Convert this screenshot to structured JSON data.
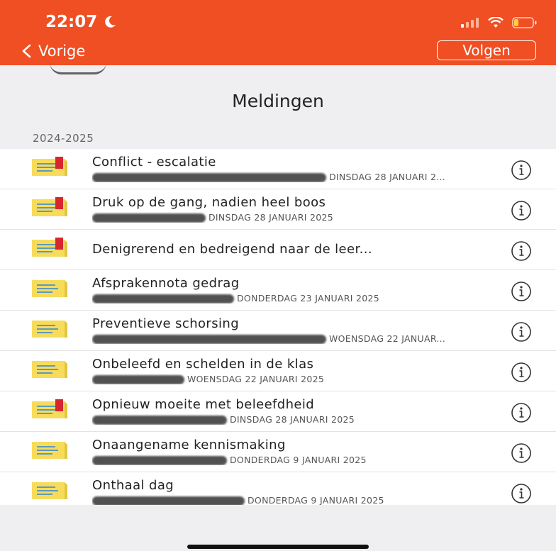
{
  "status_bar": {
    "time": "22:07"
  },
  "nav": {
    "back_label": "Vorige",
    "follow_label": "Volgen"
  },
  "page_title": "Meldingen",
  "section_label": "2024-2025",
  "items": [
    {
      "title": "Conflict - escalatie",
      "subtitle": "DINSDAG 28 JANUARI 2...",
      "flag": true,
      "redact_w": 330
    },
    {
      "title": "Druk op de gang, nadien heel boos",
      "subtitle": "DINSDAG 28 JANUARI 2025",
      "flag": true,
      "redact_w": 160
    },
    {
      "title": "Denigrerend en bedreigend naar de leer...",
      "subtitle": "",
      "flag": true,
      "redact_w": 0
    },
    {
      "title": "Afsprakennota gedrag",
      "subtitle": "DONDERDAG 23 JANUARI 2025",
      "flag": false,
      "redact_w": 200
    },
    {
      "title": "Preventieve schorsing",
      "subtitle": "WOENSDAG 22 JANUAR...",
      "flag": false,
      "redact_w": 330
    },
    {
      "title": "Onbeleefd en schelden in de klas",
      "subtitle": "WOENSDAG 22 JANUARI 2025",
      "flag": false,
      "redact_w": 130
    },
    {
      "title": "Opnieuw moeite met beleefdheid",
      "subtitle": "DINSDAG 28 JANUARI 2025",
      "flag": true,
      "redact_w": 190
    },
    {
      "title": "Onaangename kennismaking",
      "subtitle": "DONDERDAG 9 JANUARI 2025",
      "flag": false,
      "redact_w": 190
    },
    {
      "title": "Onthaal dag",
      "subtitle": "DONDERDAG 9 JANUARI 2025",
      "flag": false,
      "redact_w": 215
    }
  ],
  "colors": {
    "accent": "#f04e23",
    "note_yellow": "#f7dc5c",
    "flag_red": "#d8262f"
  }
}
